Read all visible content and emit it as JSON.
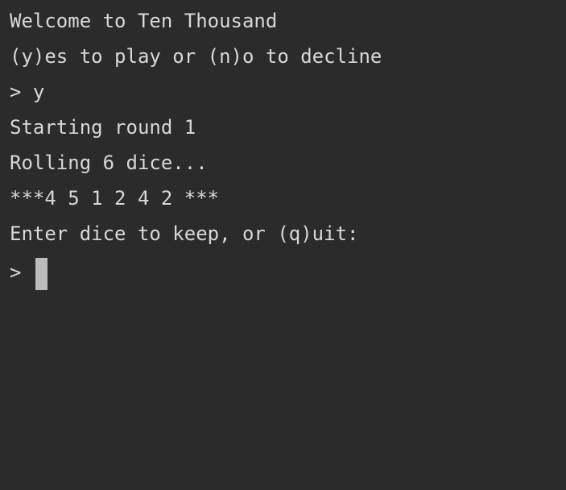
{
  "terminal": {
    "background": "#2b2b2b",
    "text_color": "#d8d8d8",
    "cursor_color": "#bcbcbc",
    "lines": [
      "Welcome to Ten Thousand",
      "(y)es to play or (n)o to decline",
      "> y",
      "Starting round 1",
      "Rolling 6 dice...",
      "***4 5 1 2 4 2 ***",
      "Enter dice to keep, or (q)uit:"
    ],
    "prompt": ">"
  }
}
